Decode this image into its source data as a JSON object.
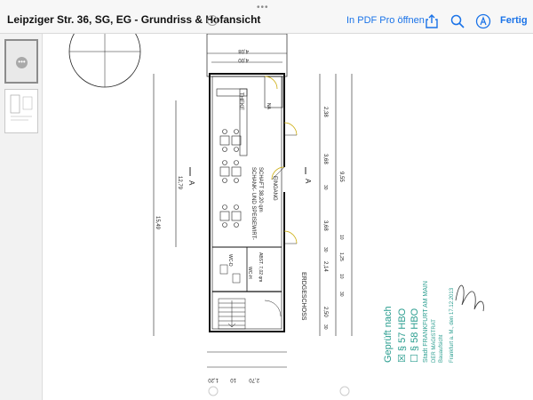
{
  "toolbar": {
    "grabber": "•••",
    "title": "Leipziger Str. 36, SG, EG - Grundriss & Hofansicht",
    "open_in_pdf_pro": "In PDF Pro öffnen",
    "done": "Fertig",
    "icons": [
      "chevron-down-icon",
      "share-icon",
      "search-icon",
      "markup-icon"
    ]
  },
  "sidebar": {
    "thumbnails": [
      {
        "page": 1,
        "selected": true
      },
      {
        "page": 2,
        "selected": false
      }
    ]
  },
  "plan": {
    "room_name_1": "SCHANK- UND SPEISEWIRT-",
    "room_name_2": "SCHAFT 38,20 qm",
    "counter": "THEKE",
    "entrance": "EINGANG",
    "floor": "ERDGESCHOSS",
    "section_mark": "A",
    "wc_label": "WC-D",
    "wc_h": "WC-H",
    "storage": "ABST. 7,02 qm",
    "na": "NA",
    "dims_left": [
      "15,49",
      "12,79"
    ],
    "dims_right": [
      "2,38",
      "3,68",
      "9,55",
      "3,68",
      "2,14",
      "2,50"
    ],
    "dims_bottom": [
      "1,20",
      "10",
      "2,70"
    ],
    "dims_top": [
      "4,08",
      "4,00"
    ],
    "dims_small": [
      "30",
      "30",
      "30",
      "10",
      "1,25",
      "10",
      "30"
    ]
  },
  "stamp": {
    "line1": "Geprüft nach",
    "line2": "☒ § 57 HBO",
    "line3": "☐ § 58 HBO",
    "line4": "Stadt FRANKFURT AM MAIN",
    "line5": "DER MAGISTRAT",
    "line6": "Bauaufsicht",
    "date": "Frankfurt a. M., den 17.12.2013"
  }
}
